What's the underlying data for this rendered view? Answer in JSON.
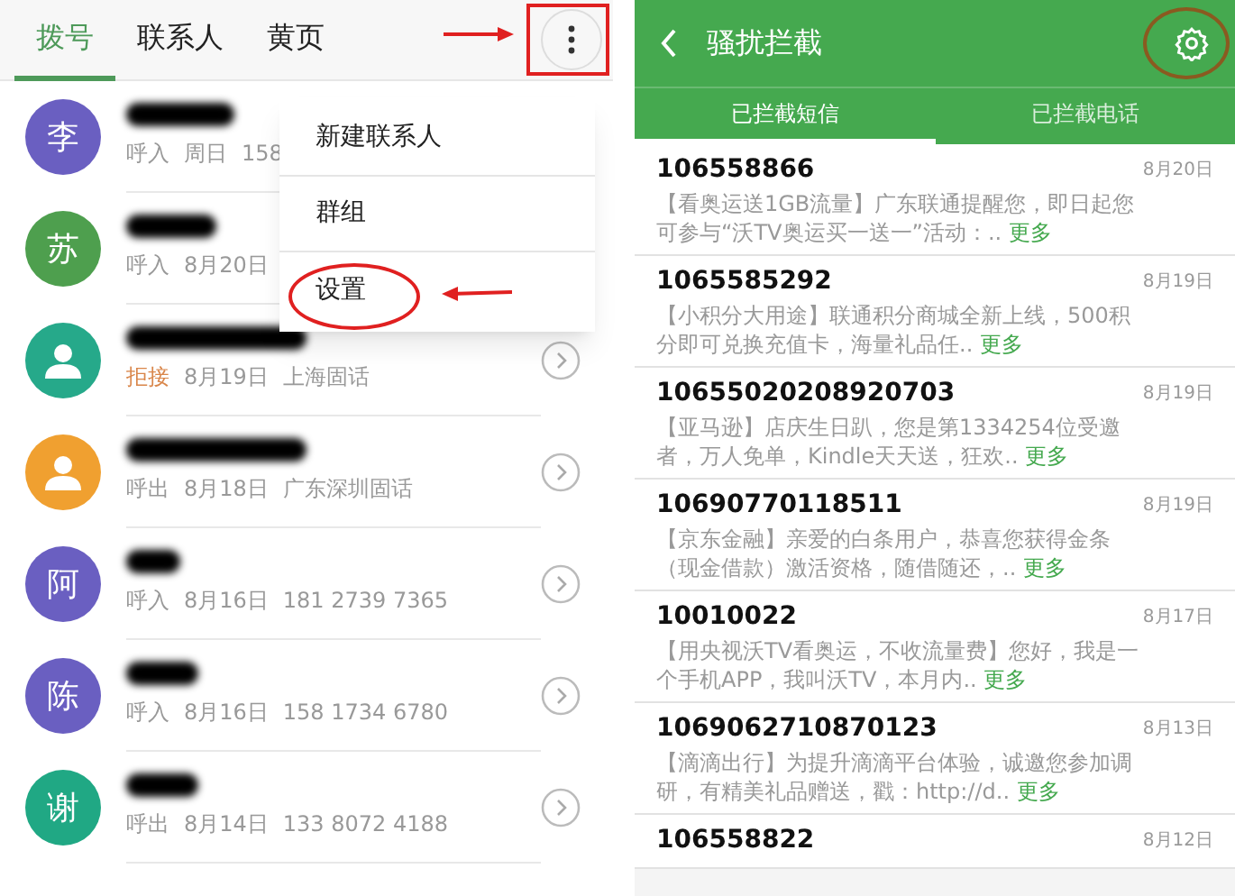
{
  "dialer": {
    "tabs": [
      {
        "label": "拨号",
        "selected": true
      },
      {
        "label": "联系人",
        "selected": false
      },
      {
        "label": "黄页",
        "selected": false
      }
    ],
    "menu": [
      "新建联系人",
      "群组",
      "设置"
    ],
    "calls": [
      {
        "kind": "letter",
        "letter": "李",
        "color": "#6a5fc1",
        "call_type": "呼入",
        "rejected": false,
        "date": "周日",
        "detail": "158",
        "detail_button": false
      },
      {
        "kind": "letter",
        "letter": "苏",
        "color": "#4e9f4e",
        "call_type": "呼入",
        "rejected": false,
        "date": "8月20日",
        "detail_button": false
      },
      {
        "kind": "person",
        "color": "#26a98a",
        "call_type": "拒接",
        "rejected": true,
        "date": "8月19日",
        "detail": "上海固话",
        "detail_button": true
      },
      {
        "kind": "person",
        "color": "#f0a030",
        "call_type": "呼出",
        "rejected": false,
        "date": "8月18日",
        "detail": "广东深圳固话",
        "detail_button": true
      },
      {
        "kind": "letter",
        "letter": "阿",
        "color": "#6a5fc1",
        "call_type": "呼入",
        "rejected": false,
        "date": "8月16日",
        "detail": "181 2739 7365",
        "detail_button": true
      },
      {
        "kind": "letter",
        "letter": "陈",
        "color": "#6a5fc1",
        "call_type": "呼入",
        "rejected": false,
        "date": "8月16日",
        "detail": "158 1734 6780",
        "detail_button": true
      },
      {
        "kind": "letter",
        "letter": "谢",
        "color": "#20a884",
        "call_type": "呼出",
        "rejected": false,
        "date": "8月14日",
        "detail": "133 8072 4188",
        "detail_button": true
      }
    ]
  },
  "blocker": {
    "title": "骚扰拦截",
    "tabs": [
      {
        "label": "已拦截短信",
        "selected": true
      },
      {
        "label": "已拦截电话",
        "selected": false
      }
    ],
    "messages": [
      {
        "sender": "106558866",
        "date": "8月20日",
        "preview": "【看奥运送1GB流量】广东联通提醒您，即日起您可参与“沃TV奥运买一送一”活动：..",
        "more": "更多"
      },
      {
        "sender": "1065585292",
        "date": "8月19日",
        "preview": "【小积分大用途】联通积分商城全新上线，500积分即可兑换充值卡，海量礼品任..",
        "more": "更多"
      },
      {
        "sender": "10655020208920703",
        "date": "8月19日",
        "preview": "【亚马逊】店庆生日趴，您是第1334254位受邀者，万人免单，Kindle天天送，狂欢..",
        "more": "更多"
      },
      {
        "sender": "10690770118511",
        "date": "8月19日",
        "preview": "【京东金融】亲爱的白条用户，恭喜您获得金条（现金借款）激活资格，随借随还，..",
        "more": "更多"
      },
      {
        "sender": "10010022",
        "date": "8月17日",
        "preview": "【用央视沃TV看奥运，不收流量费】您好，我是一个手机APP，我叫沃TV，本月内..",
        "more": "更多"
      },
      {
        "sender": "1069062710870123",
        "date": "8月13日",
        "preview": "【滴滴出行】为提升滴滴平台体验，诚邀您参加调研，有精美礼品赠送，戳：http://d..",
        "more": "更多"
      },
      {
        "sender": "106558822",
        "date": "8月12日"
      }
    ]
  }
}
